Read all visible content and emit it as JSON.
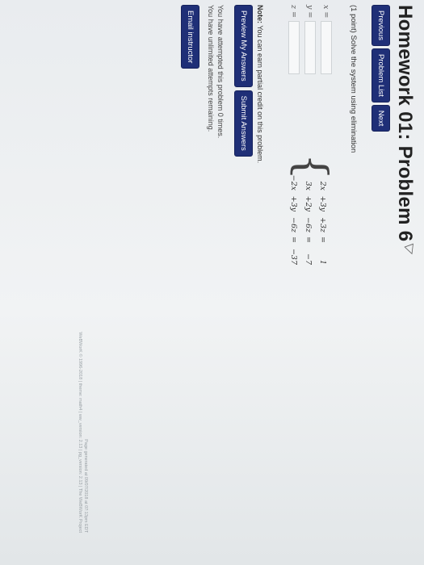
{
  "header": {
    "title": "Homework 01: Problem 6"
  },
  "nav": {
    "previous": "Previous",
    "problem_list": "Problem List",
    "next": "Next"
  },
  "problem": {
    "prompt": "(1 point) Solve the system using elimination"
  },
  "system": {
    "rows": [
      {
        "a": "2x",
        "b": "+3y",
        "c": "+3z",
        "eq": "=",
        "rhs": "1"
      },
      {
        "a": "3x",
        "b": "+2y",
        "c": "−6z",
        "eq": "=",
        "rhs": "−7"
      },
      {
        "a": "−2x",
        "b": "+3y",
        "c": "−6z",
        "eq": "=",
        "rhs": "−37"
      }
    ]
  },
  "answers": {
    "x_label": "x =",
    "y_label": "y =",
    "z_label": "z ="
  },
  "note": {
    "bold": "Note:",
    "text": " You can earn partial credit on this problem."
  },
  "actions": {
    "preview": "Preview My Answers",
    "submit": "Submit Answers"
  },
  "attempts": {
    "line1": "You have attempted this problem 0 times.",
    "line2": "You have unlimited attempts remaining."
  },
  "email": {
    "label": "Email instructor"
  },
  "footer": {
    "line1": "Page generated at 09/07/2018 at 07:13pm EDT",
    "line2": "WeBWorK © 1996-2018 | theme: math4 | ww_version: 2.13 | pg_version: 2.13 | The WeBWorK Project"
  }
}
